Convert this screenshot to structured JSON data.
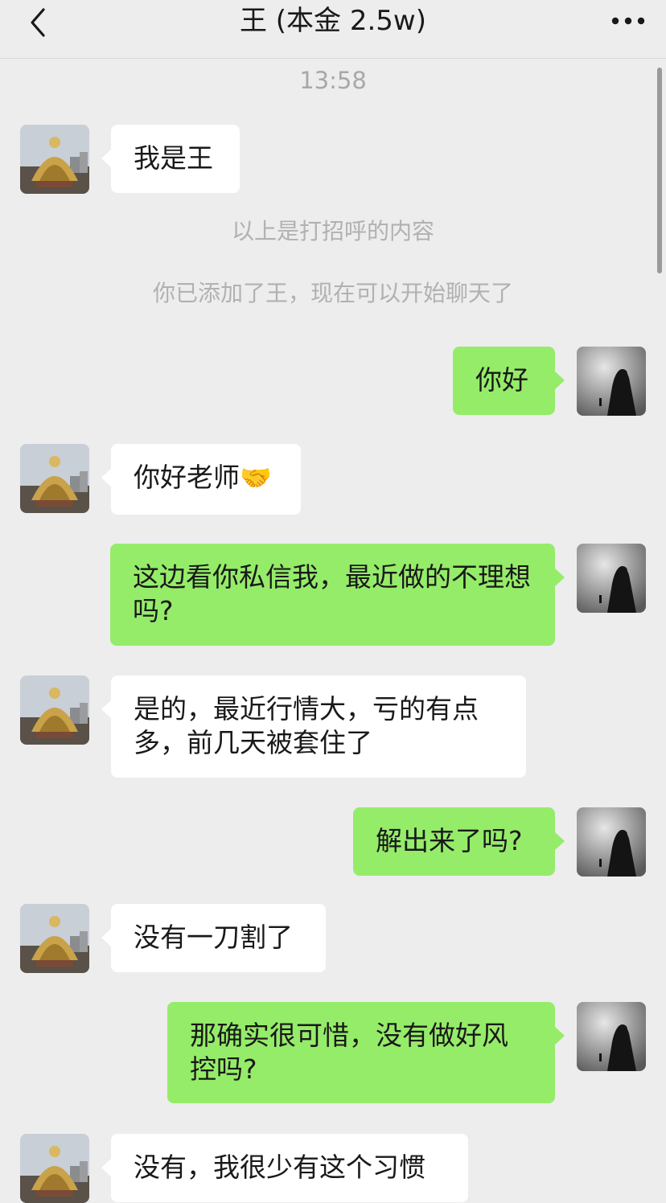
{
  "header": {
    "title": "王 (本金 2.5w)",
    "back_icon": "chevron-left-icon",
    "more_icon": "more-dots-icon"
  },
  "chat": {
    "timestamp": "13:58",
    "system_messages": [
      "以上是打招呼的内容",
      "你已添加了王，现在可以开始聊天了"
    ],
    "messages": [
      {
        "side": "left",
        "text": "我是王"
      },
      {
        "side": "right",
        "text": "你好"
      },
      {
        "side": "left",
        "text": "你好老师",
        "emoji": "🤝"
      },
      {
        "side": "right",
        "text": "这边看你私信我，最近做的不理想吗?"
      },
      {
        "side": "left",
        "text": "是的，最近行情大，亏的有点多，前几天被套住了"
      },
      {
        "side": "right",
        "text": "解出来了吗?"
      },
      {
        "side": "left",
        "text": "没有一刀割了"
      },
      {
        "side": "right",
        "text": "那确实很可惜，没有做好风控吗?"
      },
      {
        "side": "left",
        "text": "没有，我很少有这个习惯"
      }
    ]
  },
  "colors": {
    "background": "#ededed",
    "bubble_self": "#95ec69",
    "bubble_other": "#ffffff"
  }
}
